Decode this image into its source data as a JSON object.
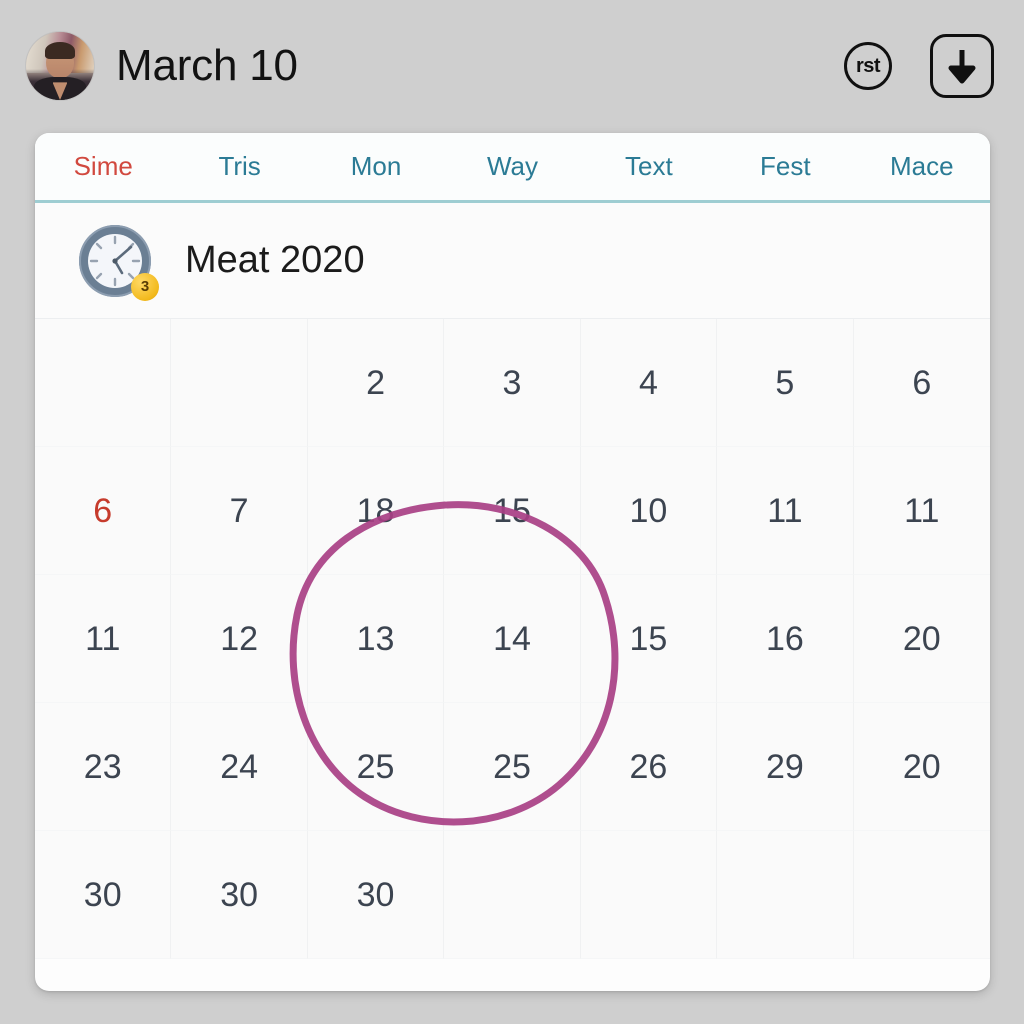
{
  "header": {
    "title": "March 10",
    "avatar_alt": "user-avatar",
    "rst_icon_label": "rst",
    "download_icon_name": "download-icon"
  },
  "tabs": [
    {
      "label": "Sime",
      "active": true
    },
    {
      "label": "Tris",
      "active": false
    },
    {
      "label": "Mon",
      "active": false
    },
    {
      "label": "Way",
      "active": false
    },
    {
      "label": "Text",
      "active": false
    },
    {
      "label": "Fest",
      "active": false
    },
    {
      "label": "Mace",
      "active": false
    }
  ],
  "month_header": {
    "title": "Meat 2020",
    "clock_icon_name": "clock-icon",
    "badge_count": "3"
  },
  "calendar": {
    "weeks": [
      [
        "",
        "",
        "2",
        "3",
        "4",
        "5",
        "6"
      ],
      [
        "6",
        "7",
        "18",
        "15",
        "10",
        "11",
        "11"
      ],
      [
        "11",
        "12",
        "13",
        "14",
        "15",
        "16",
        "20"
      ],
      [
        "23",
        "24",
        "25",
        "25",
        "26",
        "29",
        "20"
      ],
      [
        "30",
        "30",
        "30",
        "",
        "",
        "",
        ""
      ]
    ],
    "highlighted_cells": [
      [
        1,
        0
      ]
    ],
    "annotation": {
      "shape": "ellipse",
      "color": "#a83f84",
      "covers": [
        "18",
        "15",
        "13",
        "14",
        "25",
        "25"
      ]
    }
  },
  "colors": {
    "page_background": "#cfcfcf",
    "card_background": "#fdfdfd",
    "tab_active": "#d1493f",
    "tab_inactive": "#2b7b95",
    "tab_underline": "#9ecdd2",
    "day_text": "#3c4450",
    "sunday_text": "#c63b2c",
    "annotation": "#a83f84",
    "badge": "#f2b91c"
  }
}
